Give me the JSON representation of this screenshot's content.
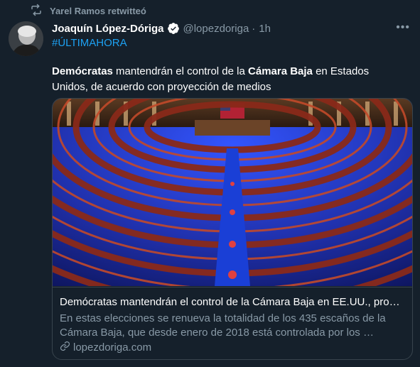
{
  "retweet": {
    "text": "Yarel Ramos retwitteó",
    "icon": "retweet-icon"
  },
  "tweet": {
    "author_name": "Joaquín López-Dóriga",
    "handle": "@lopezdoriga",
    "separator": "·",
    "time": "1h",
    "more": "•••",
    "hashtag": "#ÚLTIMAHORA",
    "text": {
      "part1": "Demócratas",
      "part2": " mantendrán el control de la ",
      "part3": "Cámara Baja",
      "part4": " en Estados Unidos,  de acuerdo con proyección de medios"
    }
  },
  "card": {
    "title": "Demócratas mantendrán el control de la Cámara Baja en EE.UU., proyectan medios",
    "description": "En estas elecciones se renueva la totalidad de los 435 escaños de la Cámara Baja, que desde enero de 2018 está controlada por los …",
    "domain": "lopezdoriga.com"
  },
  "colors": {
    "background": "#15202b",
    "accent": "#1da1f2",
    "secondary_text": "#8899a6",
    "border": "#38444d"
  }
}
